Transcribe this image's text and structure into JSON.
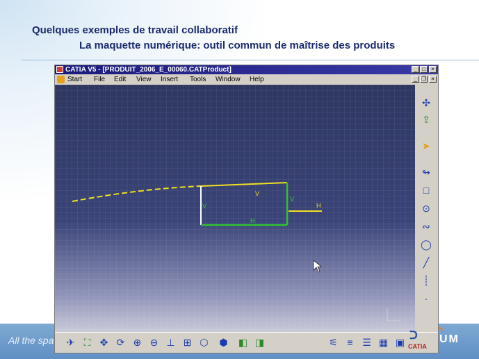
{
  "slide": {
    "title_line1": "Quelques exemples de travail collaboratif",
    "title_line2": "La maquette numérique: outil commun de maîtrise des produits",
    "footer_text": "All the spac",
    "footer_logo": "UM"
  },
  "window": {
    "title": "CATIA V5 - [PRODUIT_2006_E_00060.CATProduct]",
    "controls": {
      "minimize": "_",
      "maximize": "□",
      "close": "×"
    },
    "doc_controls": {
      "minimize": "_",
      "restore": "❐",
      "close": "×"
    }
  },
  "menu": {
    "items": [
      "Start",
      "File",
      "Edit",
      "View",
      "Insert",
      "Tools",
      "Window",
      "Help"
    ]
  },
  "sketch": {
    "constraint_labels": {
      "v_left": "V",
      "v_right": "V",
      "h_bottom": "H",
      "h_axis": "H",
      "v_top": "V"
    },
    "colors": {
      "profile_yellow": "#f0e020",
      "profile_green": "#30c030",
      "construction": "#f0e020",
      "constraint_text": "#30d030"
    }
  },
  "toolbars": {
    "right": [
      "compass-icon",
      "exit-workbench-icon",
      "select-arrow-icon",
      "profile-icon",
      "rectangle-icon",
      "circle-icon",
      "spline-icon",
      "ellipse-icon",
      "line-icon",
      "axis-icon",
      "point-icon"
    ],
    "bottom": [
      "fly-mode-icon",
      "fit-all-icon",
      "pan-icon",
      "rotate-icon",
      "zoom-in-icon",
      "zoom-out-icon",
      "normal-view-icon",
      "multi-view-icon",
      "iso-view-icon",
      "shading-icon",
      "hide-show-icon",
      "swap-space-icon",
      "constraint-icon",
      "measure-icon",
      "stack-icon",
      "table-icon",
      "window-icon"
    ],
    "brand": "CATIA"
  }
}
